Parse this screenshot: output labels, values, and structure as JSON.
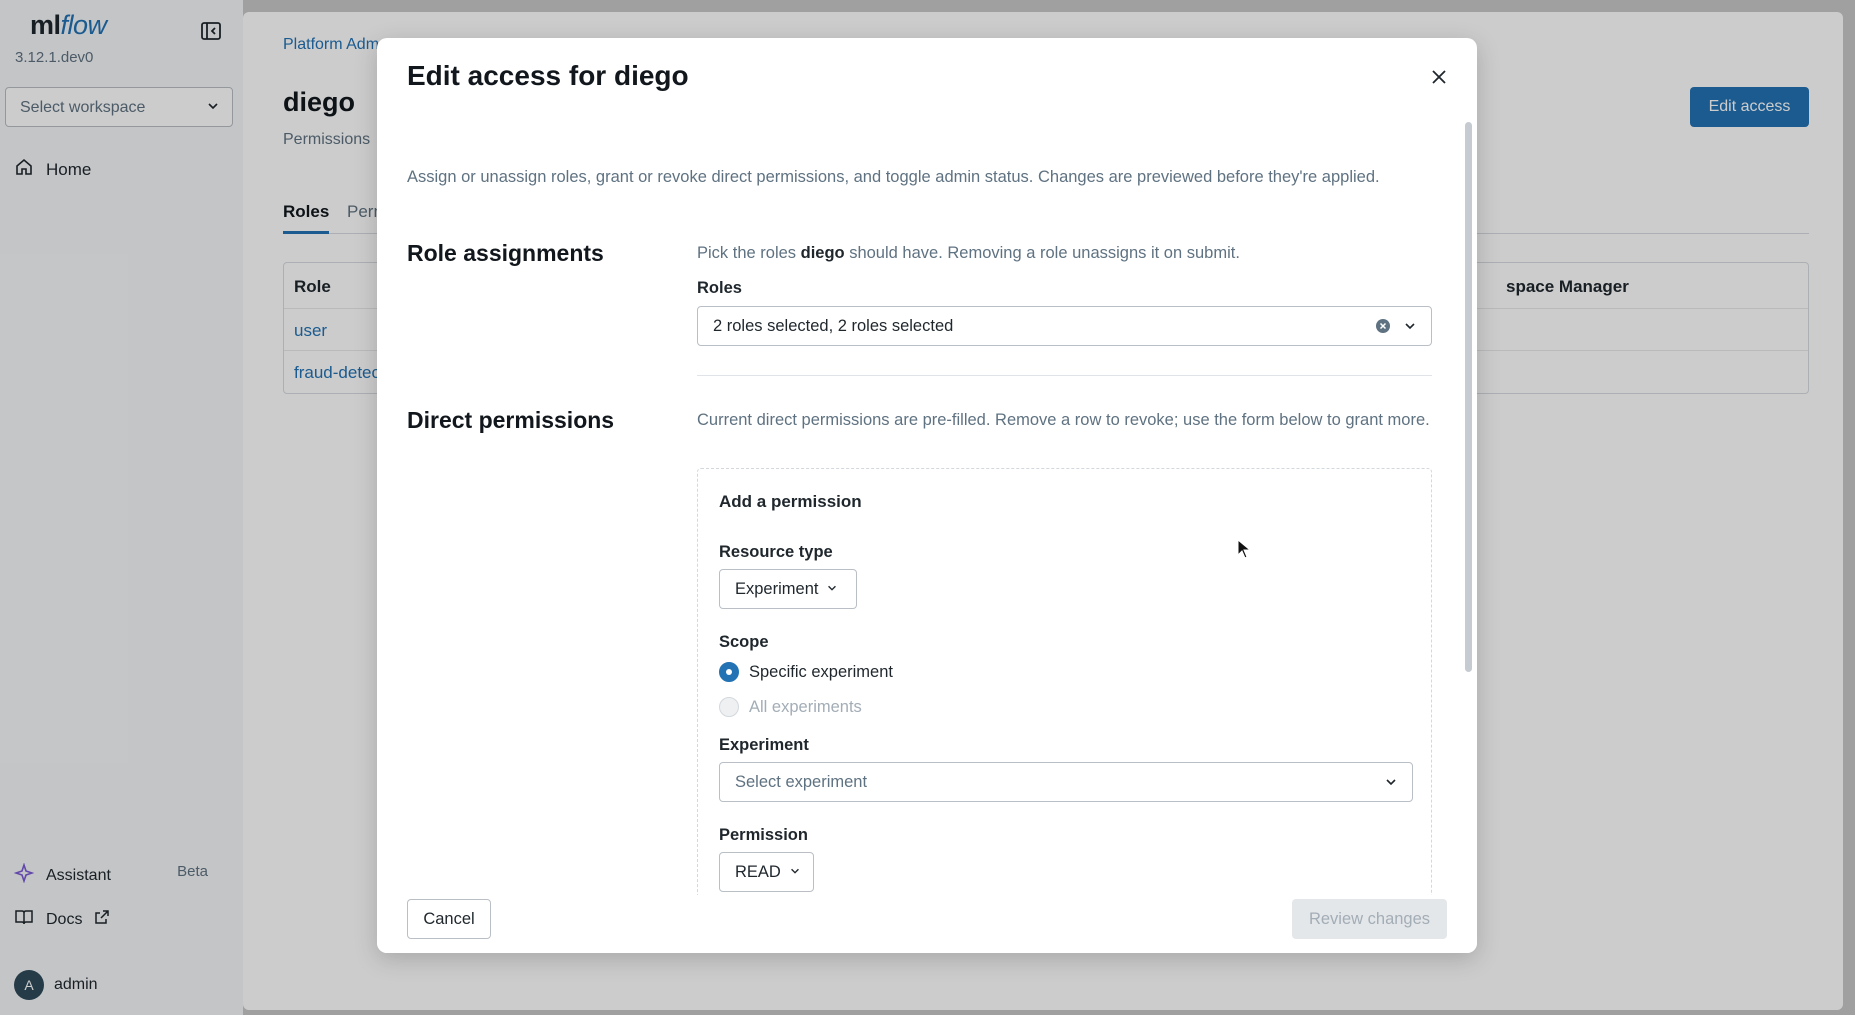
{
  "sidebar": {
    "logo_ml": "ml",
    "logo_flow": "flow",
    "version": "3.12.1.dev0",
    "workspace_placeholder": "Select workspace",
    "home_label": "Home",
    "assistant_label": "Assistant",
    "assistant_badge": "Beta",
    "docs_label": "Docs",
    "user_initial": "A",
    "user_name": "admin"
  },
  "page": {
    "breadcrumb": "Platform Adm",
    "title": "diego",
    "subtitle": "Permissions",
    "edit_access_label": "Edit access",
    "tabs": [
      {
        "label": "Roles",
        "active": true
      },
      {
        "label": "Perm",
        "active": false
      }
    ],
    "table": {
      "header_role": "Role",
      "header_right": "space Manager",
      "rows": [
        "user",
        "fraud-detec"
      ]
    }
  },
  "modal": {
    "title": "Edit access for diego",
    "intro": "Assign or unassign roles, grant or revoke direct permissions, and toggle admin status. Changes are previewed before they're applied.",
    "role_section": {
      "title": "Role assignments",
      "help_prefix": "Pick the roles ",
      "help_user": "diego",
      "help_suffix": " should have. Removing a role unassigns it on submit.",
      "roles_label": "Roles",
      "roles_value": "2 roles selected, 2 roles selected"
    },
    "direct_section": {
      "title": "Direct permissions",
      "help": "Current direct permissions are pre-filled. Remove a row to revoke; use the form below to grant more.",
      "card_title": "Add a permission",
      "resource_type_label": "Resource type",
      "resource_type_value": "Experiment",
      "scope_label": "Scope",
      "scope_options": [
        {
          "label": "Specific experiment",
          "checked": true,
          "disabled": false
        },
        {
          "label": "All experiments",
          "checked": false,
          "disabled": true
        }
      ],
      "experiment_label": "Experiment",
      "experiment_placeholder": "Select experiment",
      "permission_label": "Permission",
      "permission_value": "READ"
    },
    "cancel_label": "Cancel",
    "review_label": "Review changes"
  },
  "colors": {
    "accent": "#2272b4",
    "muted_text": "#5f7281",
    "disabled_button": "#e4e7ea"
  }
}
